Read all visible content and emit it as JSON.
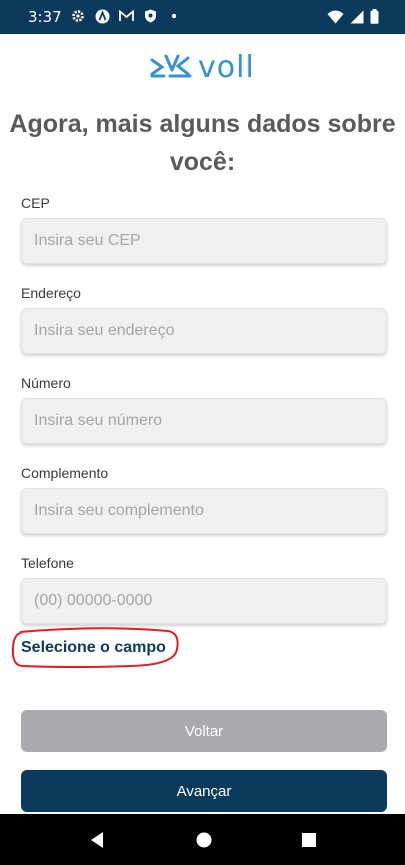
{
  "status_bar": {
    "time": "3:37",
    "left_icons": [
      "gear-icon",
      "a-icon",
      "gmail-icon",
      "shield-icon",
      "dot-icon"
    ],
    "right_icons": [
      "wifi-icon",
      "signal-icon",
      "battery-icon"
    ]
  },
  "logo": {
    "text": "voll"
  },
  "title": "Agora, mais alguns dados sobre você:",
  "form": {
    "fields": [
      {
        "label": "CEP",
        "placeholder": "Insira seu CEP",
        "value": ""
      },
      {
        "label": "Endereço",
        "placeholder": "Insira seu endereço",
        "value": ""
      },
      {
        "label": "Número",
        "placeholder": "Insira seu número",
        "value": ""
      },
      {
        "label": "Complemento",
        "placeholder": "Insira seu complemento",
        "value": ""
      },
      {
        "label": "Telefone",
        "placeholder": "(00) 00000-0000",
        "value": ""
      }
    ],
    "error_message": "Selecione o campo"
  },
  "buttons": {
    "back": "Voltar",
    "next": "Avançar"
  },
  "colors": {
    "primary": "#0b3a5c",
    "accent": "#3391d9",
    "secondary_button": "#a9a9ae",
    "annotation": "#e02020"
  }
}
